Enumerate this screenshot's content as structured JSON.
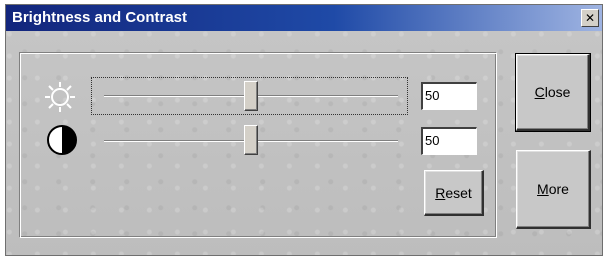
{
  "window": {
    "title": "Brightness and Contrast",
    "close_icon": "close-x-icon"
  },
  "brightness": {
    "icon": "sun-icon",
    "value": "50",
    "level": 50
  },
  "contrast": {
    "icon": "half-circle-contrast-icon",
    "value": "50",
    "level": 50
  },
  "buttons": {
    "reset_mnemonic": "R",
    "reset_rest": "eset",
    "close_mnemonic": "C",
    "close_rest": "lose",
    "more_mnemonic": "M",
    "more_rest": "ore"
  },
  "colors": {
    "titlebar_start": "#12257c",
    "titlebar_end": "#9fb4e2",
    "dialog_bg": "#c4c4c4"
  }
}
